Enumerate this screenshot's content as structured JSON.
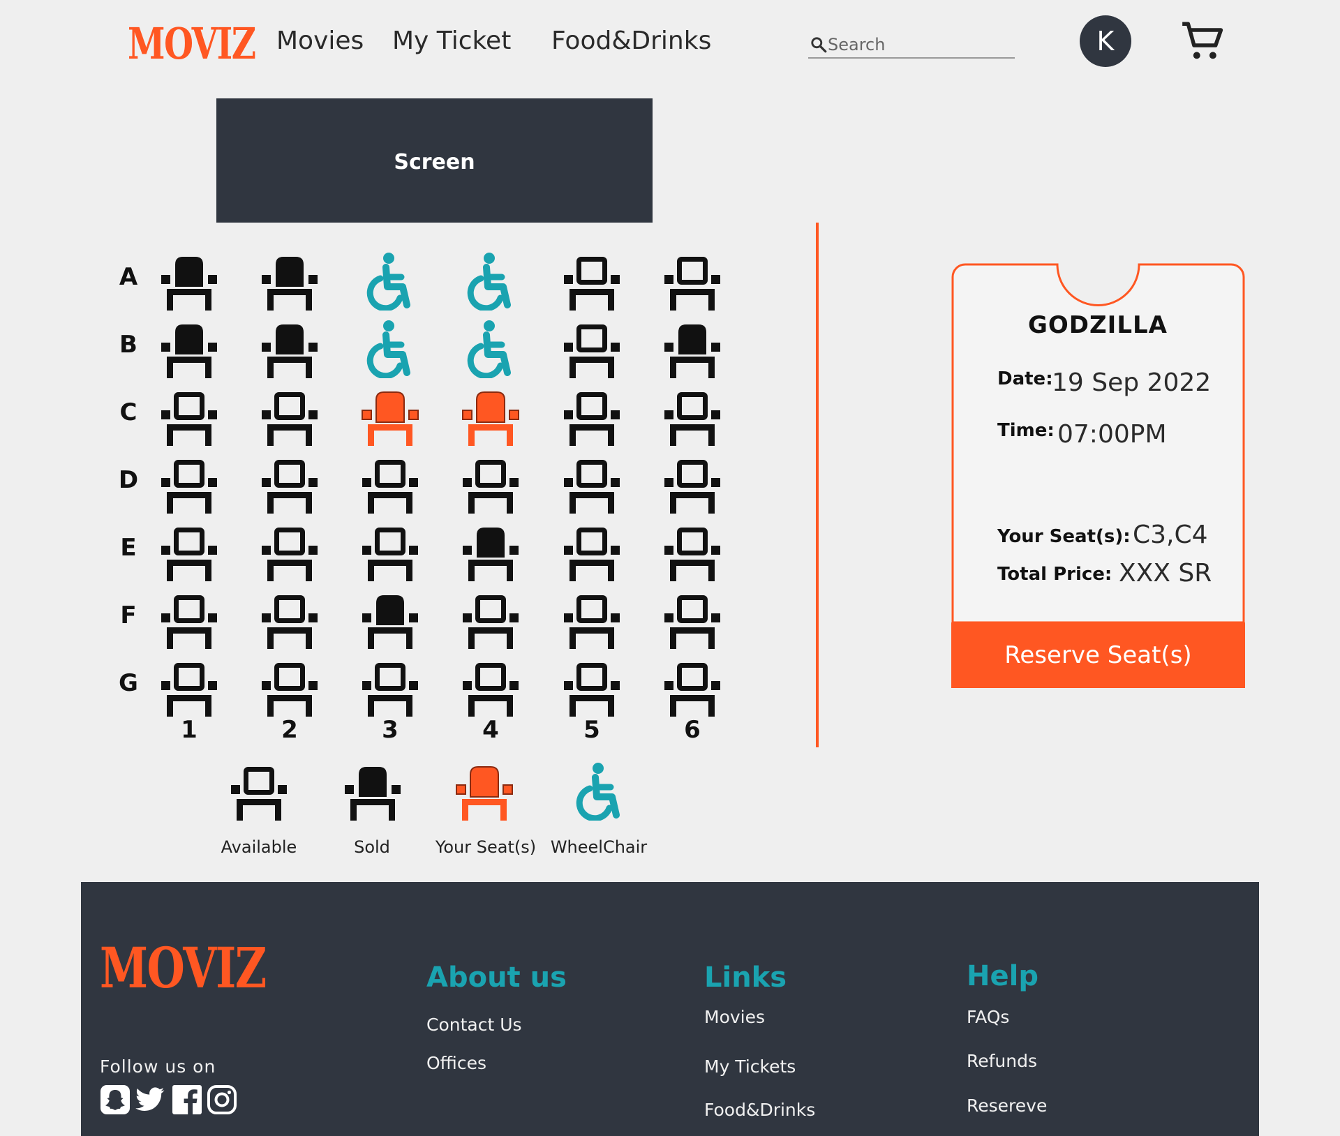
{
  "header": {
    "logo": "MOVIZ",
    "nav": [
      "Movies",
      "My Ticket",
      "Food&Drinks"
    ],
    "search_placeholder": "Search",
    "avatar_initial": "K",
    "icons": {
      "search": "search-icon",
      "cart": "cart-icon"
    }
  },
  "screen_label": "Screen",
  "seat_map": {
    "rows": [
      "A",
      "B",
      "C",
      "D",
      "E",
      "F",
      "G"
    ],
    "columns": [
      "1",
      "2",
      "3",
      "4",
      "5",
      "6"
    ],
    "status": [
      [
        "sold",
        "sold",
        "wheelchair",
        "wheelchair",
        "available",
        "available"
      ],
      [
        "sold",
        "sold",
        "wheelchair",
        "wheelchair",
        "available",
        "sold"
      ],
      [
        "available",
        "available",
        "selected",
        "selected",
        "available",
        "available"
      ],
      [
        "available",
        "available",
        "available",
        "available",
        "available",
        "available"
      ],
      [
        "available",
        "available",
        "available",
        "sold",
        "available",
        "available"
      ],
      [
        "available",
        "available",
        "sold",
        "available",
        "available",
        "available"
      ],
      [
        "available",
        "available",
        "available",
        "available",
        "available",
        "available"
      ]
    ]
  },
  "legend": [
    {
      "type": "available",
      "label": "Available"
    },
    {
      "type": "sold",
      "label": "Sold"
    },
    {
      "type": "selected",
      "label": "Your Seat(s)"
    },
    {
      "type": "wheelchair",
      "label": "WheelChair"
    }
  ],
  "ticket": {
    "movie": "GODZILLA",
    "date_label": "Date:",
    "date": "19 Sep 2022",
    "time_label": "Time:",
    "time": "07:00PM",
    "seats_label": "Your Seat(s):",
    "seats": "C3,C4",
    "price_label": "Total Price:",
    "price": "XXX SR",
    "reserve_label": "Reserve Seat(s)"
  },
  "footer": {
    "logo": "MOVIZ",
    "follow": "Follow us on",
    "social": [
      "snapchat-icon",
      "twitter-icon",
      "facebook-icon",
      "instagram-icon"
    ],
    "about": {
      "title": "About us",
      "links": [
        "Contact Us",
        "Offices"
      ]
    },
    "links": {
      "title": "Links",
      "links": [
        "Movies",
        "My Tickets",
        "Food&Drinks"
      ]
    },
    "help": {
      "title": "Help",
      "links": [
        "FAQs",
        "Refunds",
        "Resereve"
      ]
    }
  },
  "colors": {
    "accent": "#ff5722",
    "dark": "#303640",
    "teal": "#1aa3b0",
    "background": "#efefef"
  }
}
